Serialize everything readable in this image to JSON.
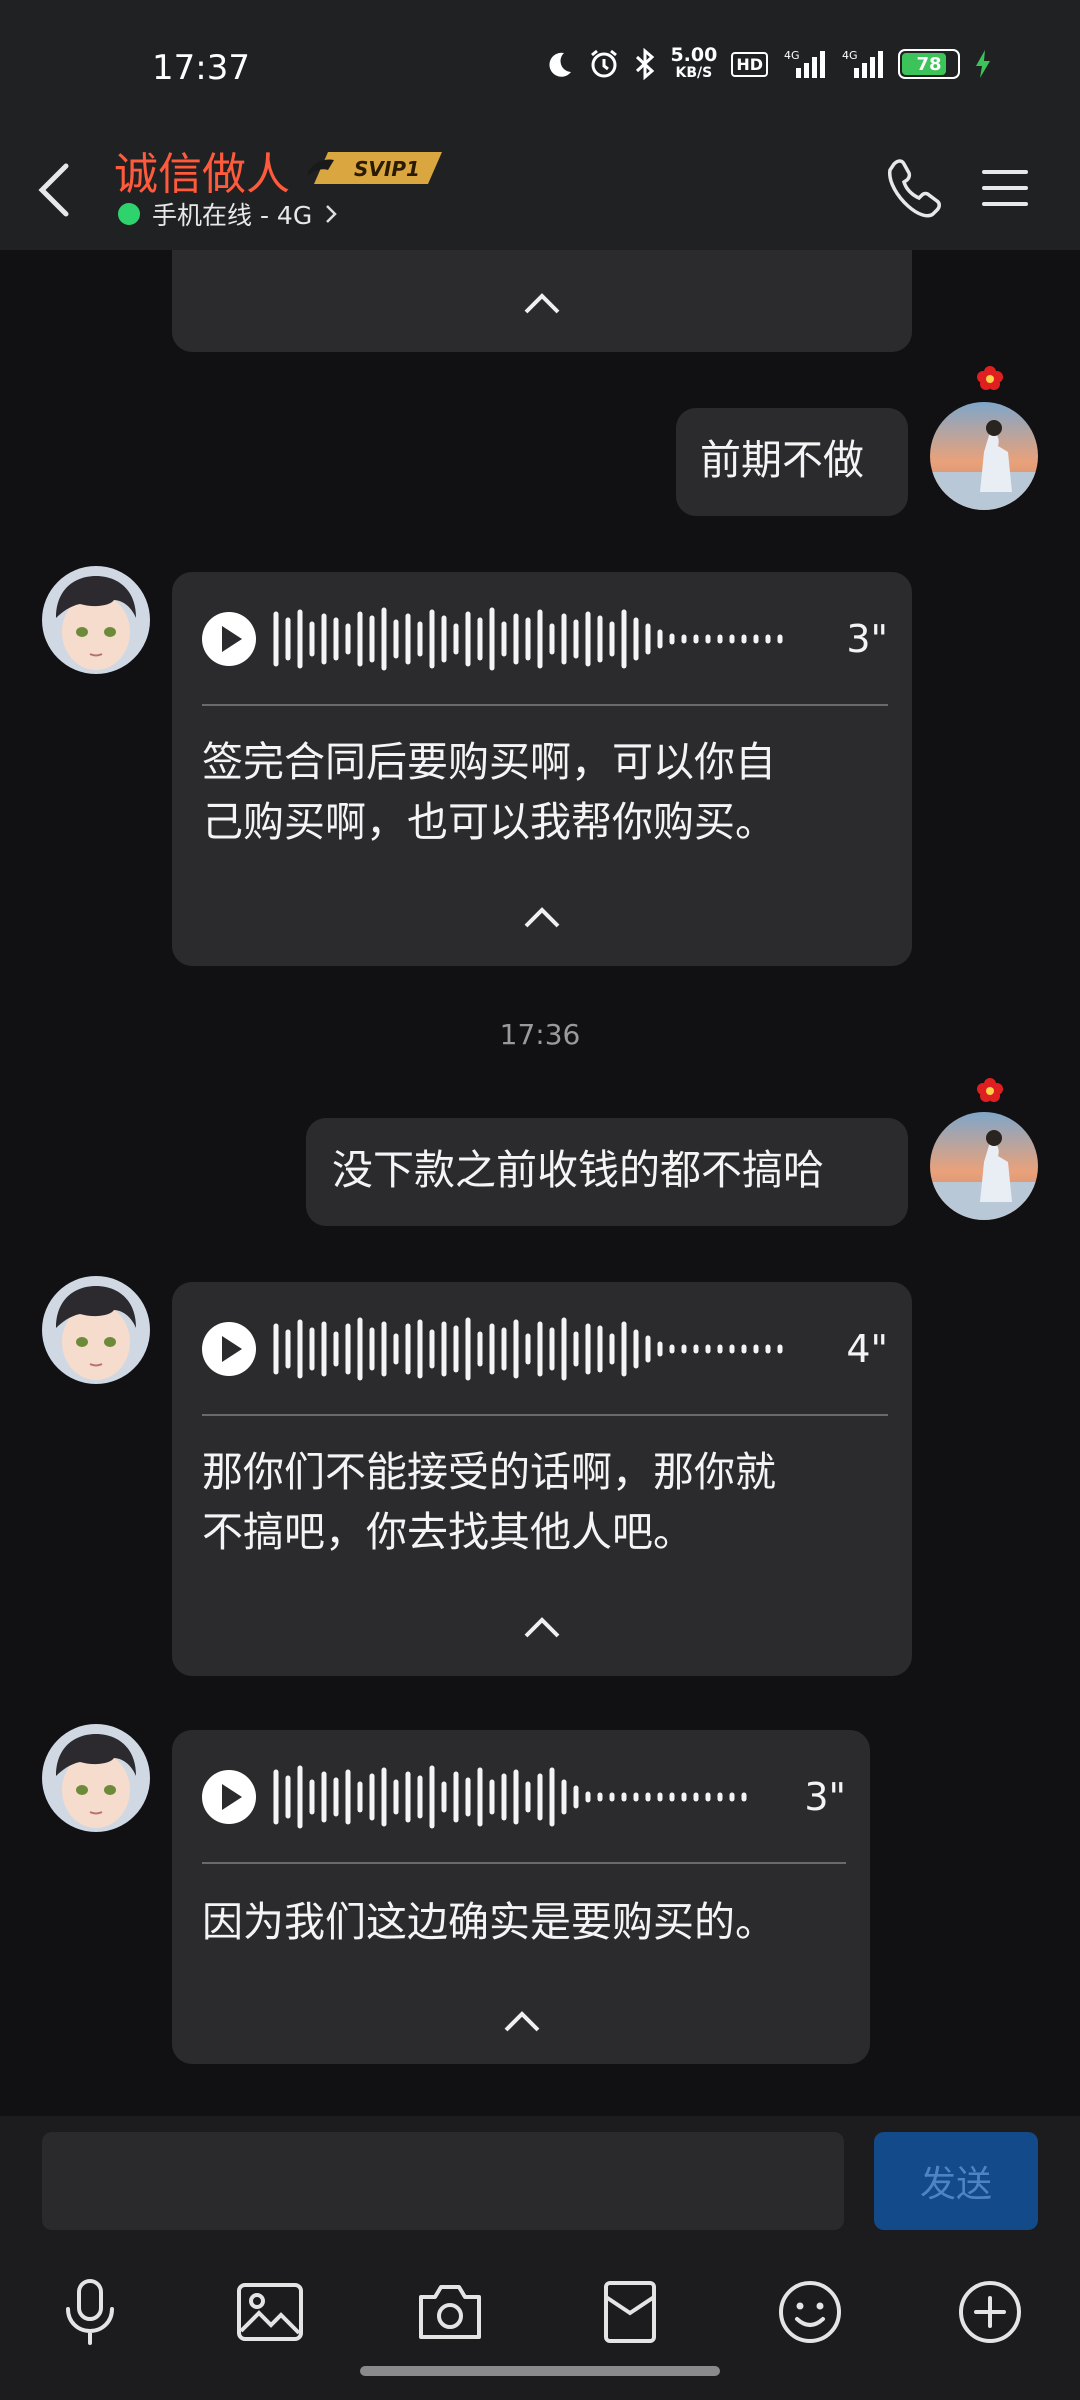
{
  "status": {
    "time": "17:37",
    "net_speed_value": "5.00",
    "net_speed_unit": "KB/S",
    "hd_label": "HD",
    "battery": "78"
  },
  "header": {
    "name": "诚信做人",
    "vip": "SVIP1",
    "online_status": "手机在线 - 4G"
  },
  "messages": [
    {
      "text_line1": "前期不做"
    },
    {
      "duration": "3\"",
      "line1": "签完合同后要购买啊，可以你自",
      "line2": "己购买啊，也可以我帮你购买。"
    },
    {
      "timestamp": "17:36"
    },
    {
      "text_line1": "没下款之前收钱的都不搞哈"
    },
    {
      "duration": "4\"",
      "line1": "那你们不能接受的话啊，那你就",
      "line2": "不搞吧，你去找其他人吧。"
    },
    {
      "duration": "3\"",
      "line1": "因为我们这边确实是要购买的。"
    }
  ],
  "input": {
    "placeholder": "",
    "send_label": "发送"
  },
  "colors": {
    "name": "#ff5a3c",
    "online": "#2fd36e",
    "send_bg": "#124a8a"
  }
}
